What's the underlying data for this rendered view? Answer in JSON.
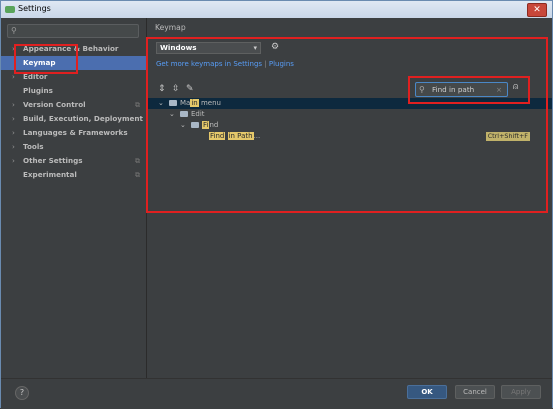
{
  "window": {
    "title": "Settings",
    "close_icon": "✕"
  },
  "sidebar": {
    "search_placeholder": "",
    "items": [
      {
        "label": "Appearance & Behavior",
        "arrow": "›",
        "copy": ""
      },
      {
        "label": "Keymap",
        "arrow": "",
        "copy": ""
      },
      {
        "label": "Editor",
        "arrow": "›",
        "copy": ""
      },
      {
        "label": "Plugins",
        "arrow": "",
        "copy": ""
      },
      {
        "label": "Version Control",
        "arrow": "›",
        "copy": "⧉"
      },
      {
        "label": "Build, Execution, Deployment",
        "arrow": "›",
        "copy": ""
      },
      {
        "label": "Languages & Frameworks",
        "arrow": "›",
        "copy": ""
      },
      {
        "label": "Tools",
        "arrow": "›",
        "copy": ""
      },
      {
        "label": "Other Settings",
        "arrow": "›",
        "copy": "⧉"
      },
      {
        "label": "Experimental",
        "arrow": "",
        "copy": "⧉"
      }
    ]
  },
  "main": {
    "header": "Keymap",
    "keymap_select": "Windows",
    "link_more": "Get more keymaps in Settings",
    "link_sep": " | ",
    "link_plugins": "Plugins",
    "find_value": "Find in path",
    "tree": {
      "main_menu": {
        "pre": "Ma",
        "hl": "in",
        "post": " menu"
      },
      "edit": "Edit",
      "find": {
        "pre": "",
        "hl": "Fi",
        "post": "nd"
      },
      "find_in_path": {
        "hl1": "Find",
        "mid": " ",
        "hl2": "in Path",
        "post": "...",
        "shortcut": "Ctrl+Shift+F"
      }
    }
  },
  "footer": {
    "ok": "OK",
    "cancel": "Cancel",
    "apply": "Apply",
    "help": "?"
  },
  "colors": {
    "accent": "#4b6eaf",
    "annotation": "#e02020",
    "link": "#589df6"
  }
}
